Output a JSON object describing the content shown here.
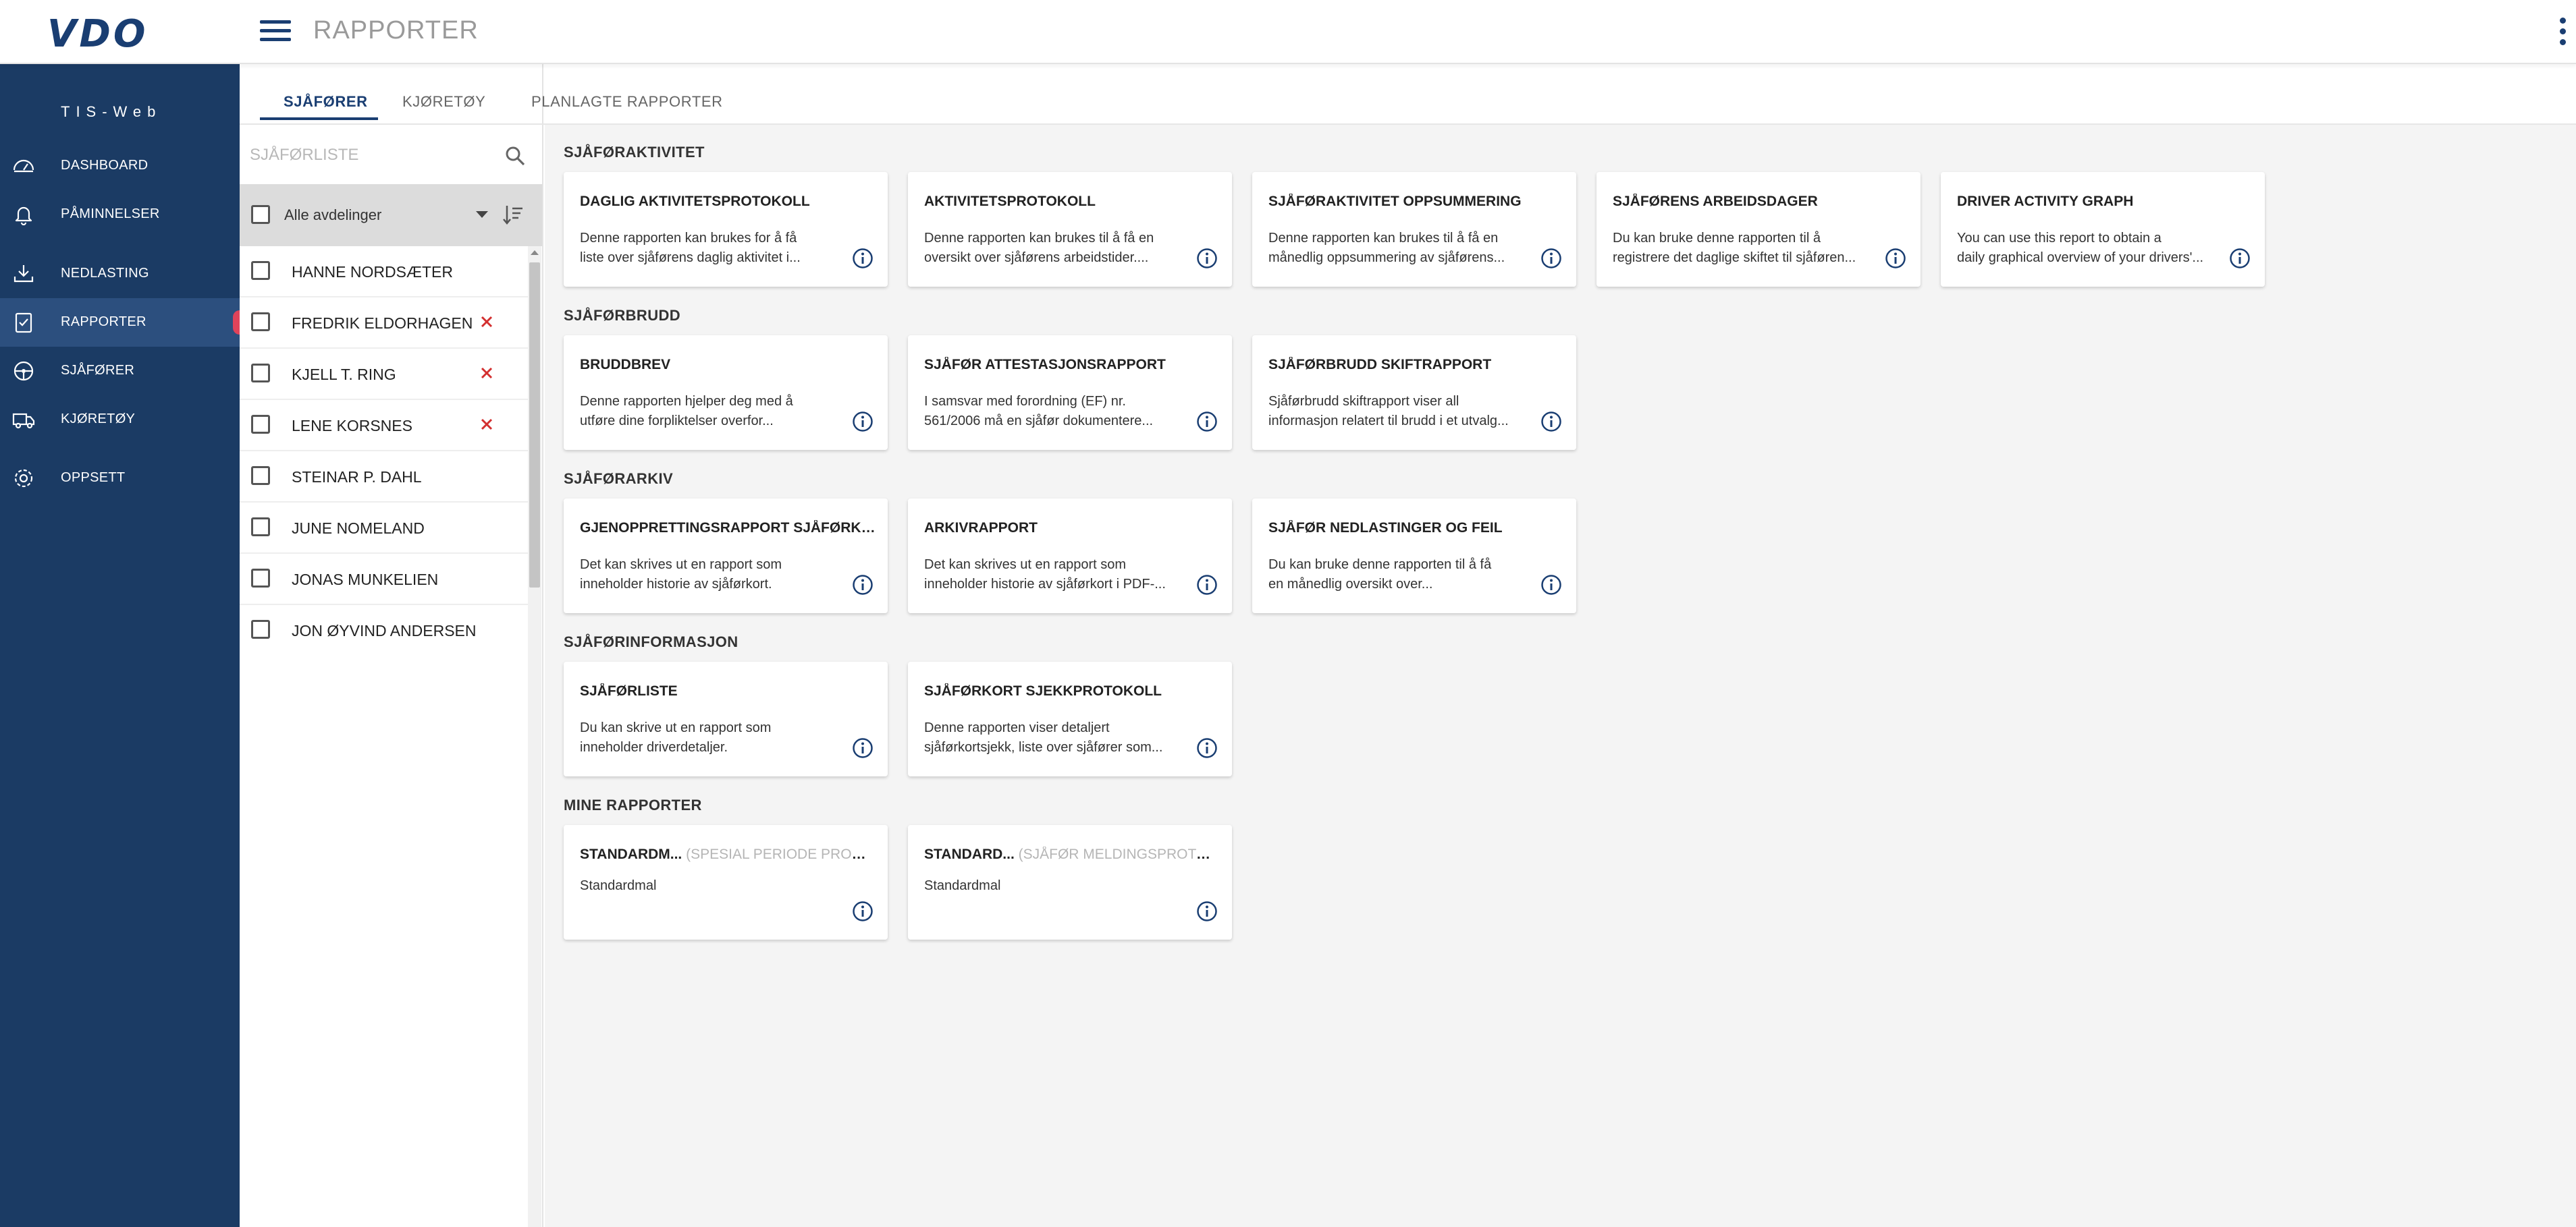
{
  "header": {
    "logo": "VDO",
    "page_title": "RAPPORTER"
  },
  "sidebar": {
    "app_name": "TIS-Web",
    "items": [
      {
        "label": "DASHBOARD",
        "icon": "dashboard-icon"
      },
      {
        "label": "PÅMINNELSER",
        "icon": "bell-icon"
      },
      {
        "label": "NEDLASTING",
        "icon": "download-icon"
      },
      {
        "label": "RAPPORTER",
        "icon": "report-icon"
      },
      {
        "label": "SJÅFØRER",
        "icon": "driver-icon"
      },
      {
        "label": "KJØRETØY",
        "icon": "truck-icon"
      },
      {
        "label": "OPPSETT",
        "icon": "gear-icon"
      }
    ],
    "active_index": 3
  },
  "tabs": [
    {
      "label": "SJÅFØRER",
      "active": true
    },
    {
      "label": "KJØRETØY",
      "active": false
    },
    {
      "label": "PLANLAGTE RAPPORTER",
      "active": false
    }
  ],
  "driver_panel": {
    "search_placeholder": "SJÅFØRLISTE",
    "department_label": "Alle avdelinger",
    "drivers": [
      {
        "name": "HANNE NORDSÆTER",
        "removable": false
      },
      {
        "name": "FREDRIK ELDORHAGEN",
        "removable": true
      },
      {
        "name": "KJELL T. RING",
        "removable": true
      },
      {
        "name": "LENE KORSNES",
        "removable": true
      },
      {
        "name": "STEINAR P. DAHL",
        "removable": false
      },
      {
        "name": "JUNE NOMELAND",
        "removable": false
      },
      {
        "name": "JONAS MUNKELIEN",
        "removable": false
      },
      {
        "name": "JON ØYVIND ANDERSEN",
        "removable": false
      }
    ]
  },
  "sections": [
    {
      "title": "SJÅFØRAKTIVITET",
      "cards": [
        {
          "title": "DAGLIG AKTIVITETSPROTOKOLL",
          "desc1": "Denne rapporten kan brukes for å få",
          "desc2": "liste over sjåførens daglig aktivitet i..."
        },
        {
          "title": "AKTIVITETSPROTOKOLL",
          "desc1": "Denne rapporten kan brukes til å få en",
          "desc2": "oversikt over sjåførens arbeidstider...."
        },
        {
          "title": "SJÅFØRAKTIVITET OPPSUMMERING",
          "desc1": "Denne rapporten kan brukes til å få en",
          "desc2": "månedlig oppsummering av sjåførens..."
        },
        {
          "title": "SJÅFØRENS ARBEIDSDAGER",
          "desc1": "Du kan bruke denne rapporten til å",
          "desc2": "registrere det daglige skiftet til sjåføren..."
        },
        {
          "title": "DRIVER ACTIVITY GRAPH",
          "desc1": "You can use this report to obtain a",
          "desc2": "daily graphical overview of your drivers'..."
        }
      ]
    },
    {
      "title": "SJÅFØRBRUDD",
      "cards": [
        {
          "title": "BRUDDBREV",
          "desc1": "Denne rapporten hjelper deg med å",
          "desc2": "utføre dine forpliktelser overfor..."
        },
        {
          "title": "SJÅFØR ATTESTASJONSRAPPORT",
          "desc1": "I samsvar med forordning (EF) nr.",
          "desc2": "561/2006 må en sjåfør dokumentere..."
        },
        {
          "title": "SJÅFØRBRUDD SKIFTRAPPORT",
          "desc1": "Sjåførbrudd skiftrapport viser all",
          "desc2": "informasjon relatert til brudd i et utvalg..."
        }
      ]
    },
    {
      "title": "SJÅFØRARKIV",
      "cards": [
        {
          "title": "GJENOPPRETTINGSRAPPORT SJÅFØRKORT",
          "desc1": "Det kan skrives ut en rapport som",
          "desc2": "inneholder historie av sjåførkort."
        },
        {
          "title": "ARKIVRAPPORT",
          "desc1": "Det kan skrives ut en rapport som",
          "desc2": "inneholder historie av sjåførkort i PDF-..."
        },
        {
          "title": "SJÅFØR NEDLASTINGER OG FEIL",
          "desc1": "Du kan bruke denne rapporten til å få",
          "desc2": "en månedlig oversikt over..."
        }
      ]
    },
    {
      "title": "SJÅFØRINFORMASJON",
      "cards": [
        {
          "title": "SJÅFØRLISTE",
          "desc1": "Du kan skrive ut en rapport som",
          "desc2": "inneholder driverdetaljer."
        },
        {
          "title": "SJÅFØRKORT SJEKKPROTOKOLL",
          "desc1": "Denne rapporten viser detaljert",
          "desc2": "sjåførkortsjekk, liste over sjåfører som..."
        }
      ]
    },
    {
      "title": "MINE RAPPORTER",
      "cards": [
        {
          "title": "STANDARDM...",
          "sub": "(SPESIAL PERIODE PROTOK...",
          "desc1": "Standardmal",
          "desc2": ""
        },
        {
          "title": "STANDARD...",
          "sub": "(SJÅFØR MELDINGSPROTOK...",
          "desc1": "Standardmal",
          "desc2": ""
        }
      ]
    }
  ],
  "colors": {
    "brand": "#1a3e72",
    "sidebar": "#1b3b64",
    "remove": "#d32f2f",
    "active_indicator": "#e0435a"
  }
}
